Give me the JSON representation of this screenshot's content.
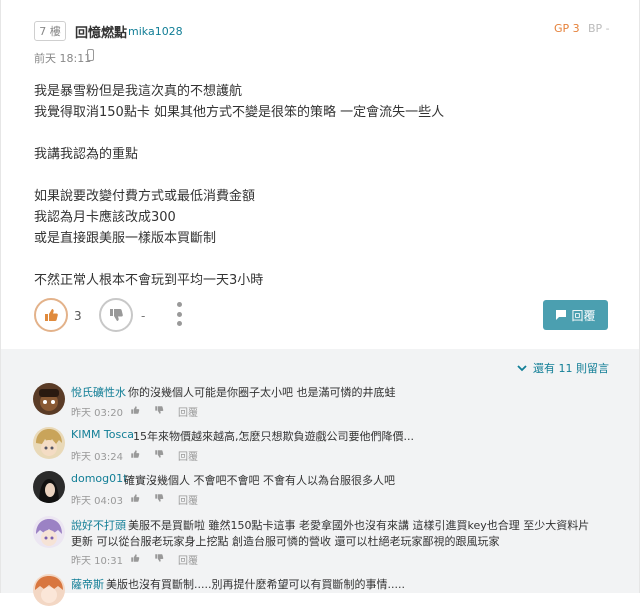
{
  "post": {
    "floor": "7 樓",
    "author_name": "回憶燃點",
    "author_id": "mika1028",
    "gp": "GP 3",
    "bp": "BP -",
    "time": "前天 18:11",
    "lines": [
      "我是暴雪粉但是我這次真的不想護航",
      "我覺得取消150點卡 如果其他方式不變是很笨的策略 一定會流失一些人",
      "",
      "我講我認為的重點",
      "",
      "如果說要改變付費方式或最低消費金額",
      "我認為月卡應該改成300",
      "或是直接跟美服一樣版本買斷制",
      "",
      "不然正常人根本不會玩到平均一天3小時"
    ],
    "like_count": "3",
    "dislike_count": "-",
    "reply_label": "回覆",
    "colors": {
      "accent": "#117e96",
      "reply_button": "#4b9fb0",
      "gp": "#e5813a"
    }
  },
  "comments_section": {
    "more_label": "還有 11 則留言",
    "items": [
      {
        "name": "悅氏礦性水",
        "text": "你的沒幾個人可能是你圈子太小吧 也是滿可憐的井底蛙",
        "text2": "",
        "time": "昨天 03:20",
        "reply": "回覆",
        "avatar": "brown-hat-avatar"
      },
      {
        "name": "KIMM Tosca",
        "text": "15年來物價越來越高,怎麼只想欺負遊戲公司要他們降價...",
        "text2": "",
        "time": "昨天 03:24",
        "reply": "回覆",
        "avatar": "blonde-girl-avatar"
      },
      {
        "name": "domog01t",
        "text": "確實沒幾個人 不會吧不會吧 不會有人以為台服很多人吧",
        "text2": "",
        "time": "昨天 04:03",
        "reply": "回覆",
        "avatar": "dark-hair-avatar"
      },
      {
        "name": "說好不打頭",
        "text": "美服不是買斷啦 雖然150點卡這事 老愛拿國外也沒有來講 這樣引進買key也合理 至少大資料片",
        "text2": "更新 可以從台服老玩家身上挖點 創造台服可憐的營收 還可以杜絕老玩家鄙視的跟風玩家",
        "time": "昨天 10:31",
        "reply": "回覆",
        "avatar": "purple-hair-avatar"
      },
      {
        "name": "薩帝斯",
        "text": "美版也沒有買斷制.....別再提什麼希望可以有買斷制的事情.....",
        "text2": "",
        "time": "",
        "reply": "",
        "avatar": "anime-avatar"
      }
    ]
  }
}
